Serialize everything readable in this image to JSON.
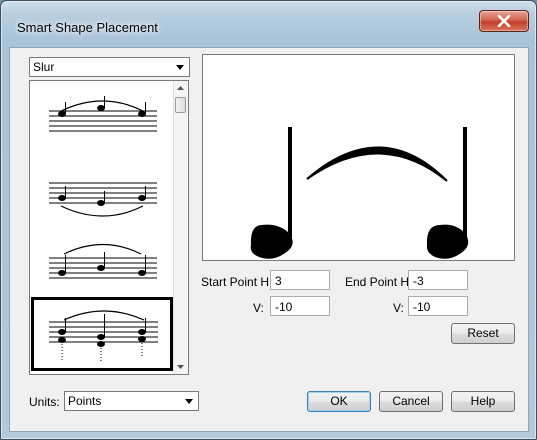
{
  "window": {
    "title": "Smart Shape Placement"
  },
  "shape_select": {
    "value": "Slur"
  },
  "shape_list": {
    "items": [
      {
        "name": "slur-over-notes",
        "selected": false
      },
      {
        "name": "slur-under-notes",
        "selected": false
      },
      {
        "name": "slur-over-notes-alt",
        "selected": false
      },
      {
        "name": "slur-over-chords",
        "selected": true
      }
    ]
  },
  "start_point": {
    "h_label": "Start Point H:",
    "h_value": "3",
    "v_label": "V:",
    "v_value": "-10"
  },
  "end_point": {
    "h_label": "End Point H:",
    "h_value": "-3",
    "v_label": "V:",
    "v_value": "-10"
  },
  "buttons": {
    "reset": "Reset",
    "ok": "OK",
    "cancel": "Cancel",
    "help": "Help"
  },
  "units": {
    "label": "Units:",
    "value": "Points"
  },
  "colors": {
    "close_button": "#c7432e",
    "selection_border": "#000000",
    "default_button_border": "#3c7fb1"
  },
  "icons": {
    "close": "close-icon",
    "dropdown": "chevron-down-icon"
  }
}
